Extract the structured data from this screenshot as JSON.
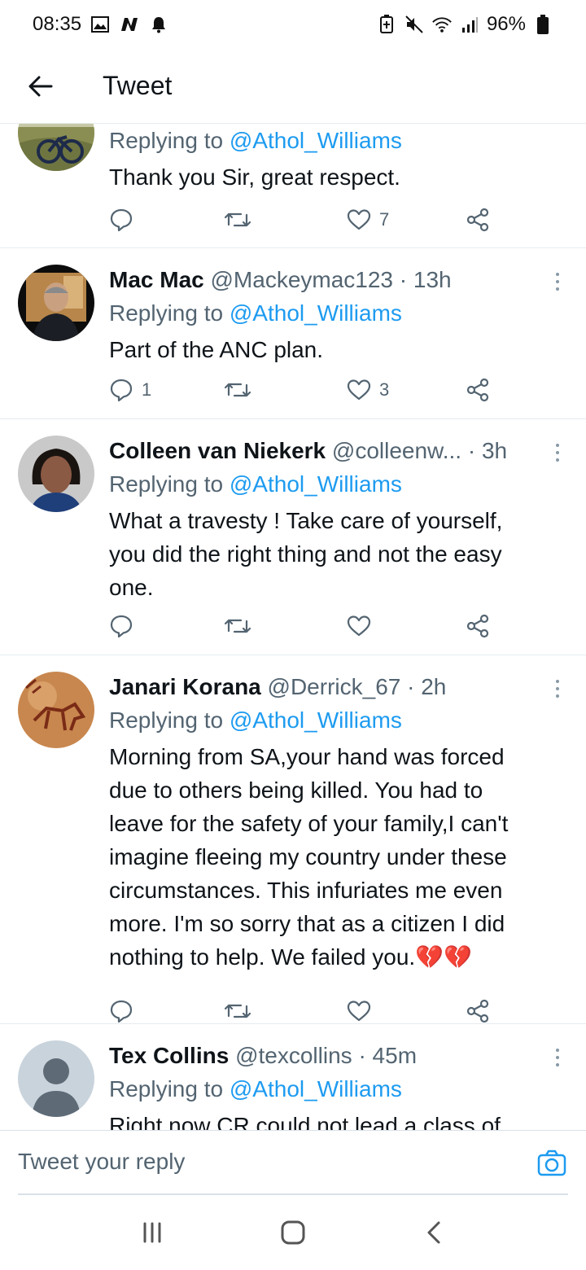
{
  "status_bar": {
    "time": "08:35",
    "battery": "96%"
  },
  "header": {
    "title": "Tweet"
  },
  "tweets": [
    {
      "name": "",
      "handle": "",
      "time": "",
      "replying_label": "Replying to",
      "replying_to": "@Athol_Williams",
      "body": [
        "Thank you Sir, great respect."
      ],
      "replies": "",
      "likes": "7"
    },
    {
      "name": "Mac Mac",
      "handle": "@Mackeymac123",
      "time": "· 13h",
      "replying_label": "Replying to",
      "replying_to": "@Athol_Williams",
      "body": [
        "Part of the ANC plan."
      ],
      "replies": "1",
      "likes": "3"
    },
    {
      "name": "Colleen van Niekerk",
      "handle": "@colleenw...",
      "time": "· 3h",
      "replying_label": "Replying to",
      "replying_to": "@Athol_Williams",
      "body": [
        "What a travesty ! Take care of yourself,",
        "you did the right thing and not the easy",
        "one."
      ],
      "replies": "",
      "likes": ""
    },
    {
      "name": "Janari Korana",
      "handle": "@Derrick_67",
      "time": "· 2h",
      "replying_label": "Replying to",
      "replying_to": "@Athol_Williams",
      "body": [
        "Morning from SA,your hand was forced",
        "due to others being killed. You had to",
        "leave for the safety of your family,I can't",
        "imagine fleeing my country under these",
        "circumstances. This infuriates me even",
        "more. I'm so sorry that as a citizen I did",
        "nothing to   help. We failed you.💔💔"
      ],
      "replies": "",
      "likes": ""
    },
    {
      "name": "Tex Collins",
      "handle": "@texcollins",
      "time": "· 45m",
      "replying_label": "Replying to",
      "replying_to": "@Athol_Williams",
      "body": [
        "Right now CR could not lead a class of"
      ],
      "replies": "",
      "likes": ""
    }
  ],
  "reply_box": {
    "placeholder": "Tweet your reply"
  },
  "icons": {
    "back": "arrow-left-icon",
    "reply": "comment-icon",
    "retweet": "retweet-icon",
    "like": "heart-icon",
    "share": "share-icon",
    "more": "more-vertical-icon",
    "camera": "camera-icon"
  },
  "colors": {
    "accent": "#1d9bf0",
    "text": "#0f1419",
    "muted": "#536471"
  }
}
